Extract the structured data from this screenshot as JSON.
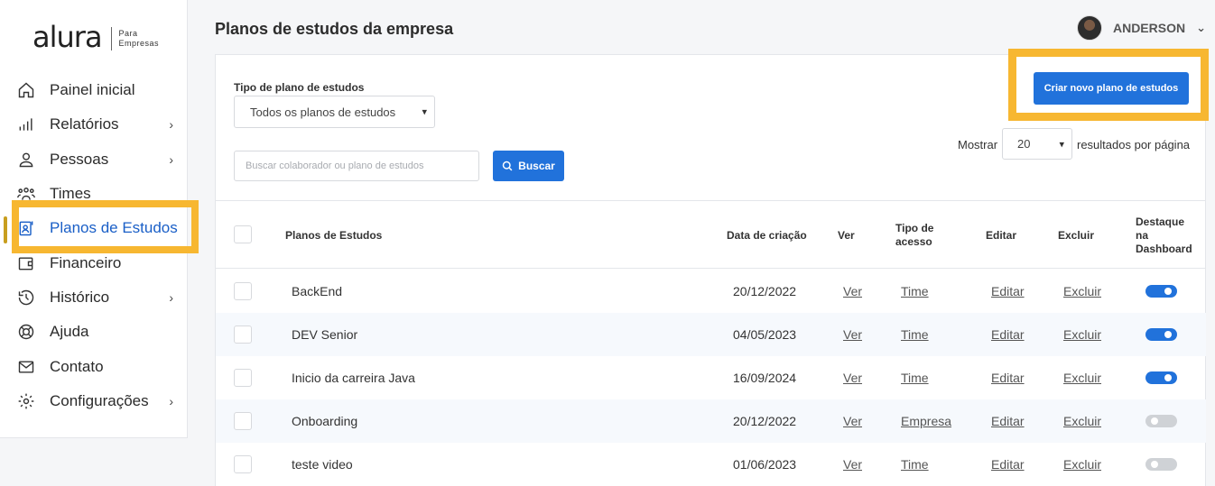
{
  "brand": {
    "logo_text": "alura",
    "logo_sub_line1": "Para",
    "logo_sub_line2": "Empresas"
  },
  "sidebar": {
    "items": [
      {
        "label": "Painel inicial",
        "icon": "home-icon",
        "has_submenu": false
      },
      {
        "label": "Relatórios",
        "icon": "bar-chart-icon",
        "has_submenu": true
      },
      {
        "label": "Pessoas",
        "icon": "user-icon",
        "has_submenu": true
      },
      {
        "label": "Times",
        "icon": "team-icon",
        "has_submenu": false
      },
      {
        "label": "Planos de Estudos",
        "icon": "study-plan-icon",
        "has_submenu": false,
        "active": true
      },
      {
        "label": "Financeiro",
        "icon": "wallet-icon",
        "has_submenu": false
      },
      {
        "label": "Histórico",
        "icon": "history-icon",
        "has_submenu": true
      },
      {
        "label": "Ajuda",
        "icon": "lifebuoy-icon",
        "has_submenu": false
      },
      {
        "label": "Contato",
        "icon": "mail-icon",
        "has_submenu": false
      },
      {
        "label": "Configurações",
        "icon": "gear-icon",
        "has_submenu": true
      }
    ]
  },
  "header": {
    "title": "Planos de estudos da empresa",
    "user_name": "ANDERSON"
  },
  "filters": {
    "type_label": "Tipo de plano de estudos",
    "type_selected": "Todos os planos de estudos",
    "search_placeholder": "Buscar colaborador ou plano de estudos",
    "search_button": "Buscar",
    "create_button": "Criar novo plano de estudos",
    "show_label": "Mostrar",
    "per_page": "20",
    "results_label": "resultados por página"
  },
  "table": {
    "headers": {
      "name": "Planos de Estudos",
      "created": "Data de criação",
      "view": "Ver",
      "access_1": "Tipo de",
      "access_2": "acesso",
      "edit": "Editar",
      "delete": "Excluir",
      "dash_1": "Destaque",
      "dash_2": "na",
      "dash_3": "Dashboard"
    },
    "rows": [
      {
        "name": "BackEnd",
        "created": "20/12/2022",
        "view": "Ver",
        "access": "Time",
        "edit": "Editar",
        "delete": "Excluir",
        "dashboard": true
      },
      {
        "name": "DEV Senior",
        "created": "04/05/2023",
        "view": "Ver",
        "access": "Time",
        "edit": "Editar",
        "delete": "Excluir",
        "dashboard": true
      },
      {
        "name": "Inicio da carreira Java",
        "created": "16/09/2024",
        "view": "Ver",
        "access": "Time",
        "edit": "Editar",
        "delete": "Excluir",
        "dashboard": true
      },
      {
        "name": "Onboarding",
        "created": "20/12/2022",
        "view": "Ver",
        "access": "Empresa",
        "edit": "Editar",
        "delete": "Excluir",
        "dashboard": false
      },
      {
        "name": "teste video",
        "created": "01/06/2023",
        "view": "Ver",
        "access": "Time",
        "edit": "Editar",
        "delete": "Excluir",
        "dashboard": false
      }
    ]
  },
  "colors": {
    "primary": "#2172db",
    "highlight": "#f7b731",
    "active_nav": "#1a5fc7"
  }
}
